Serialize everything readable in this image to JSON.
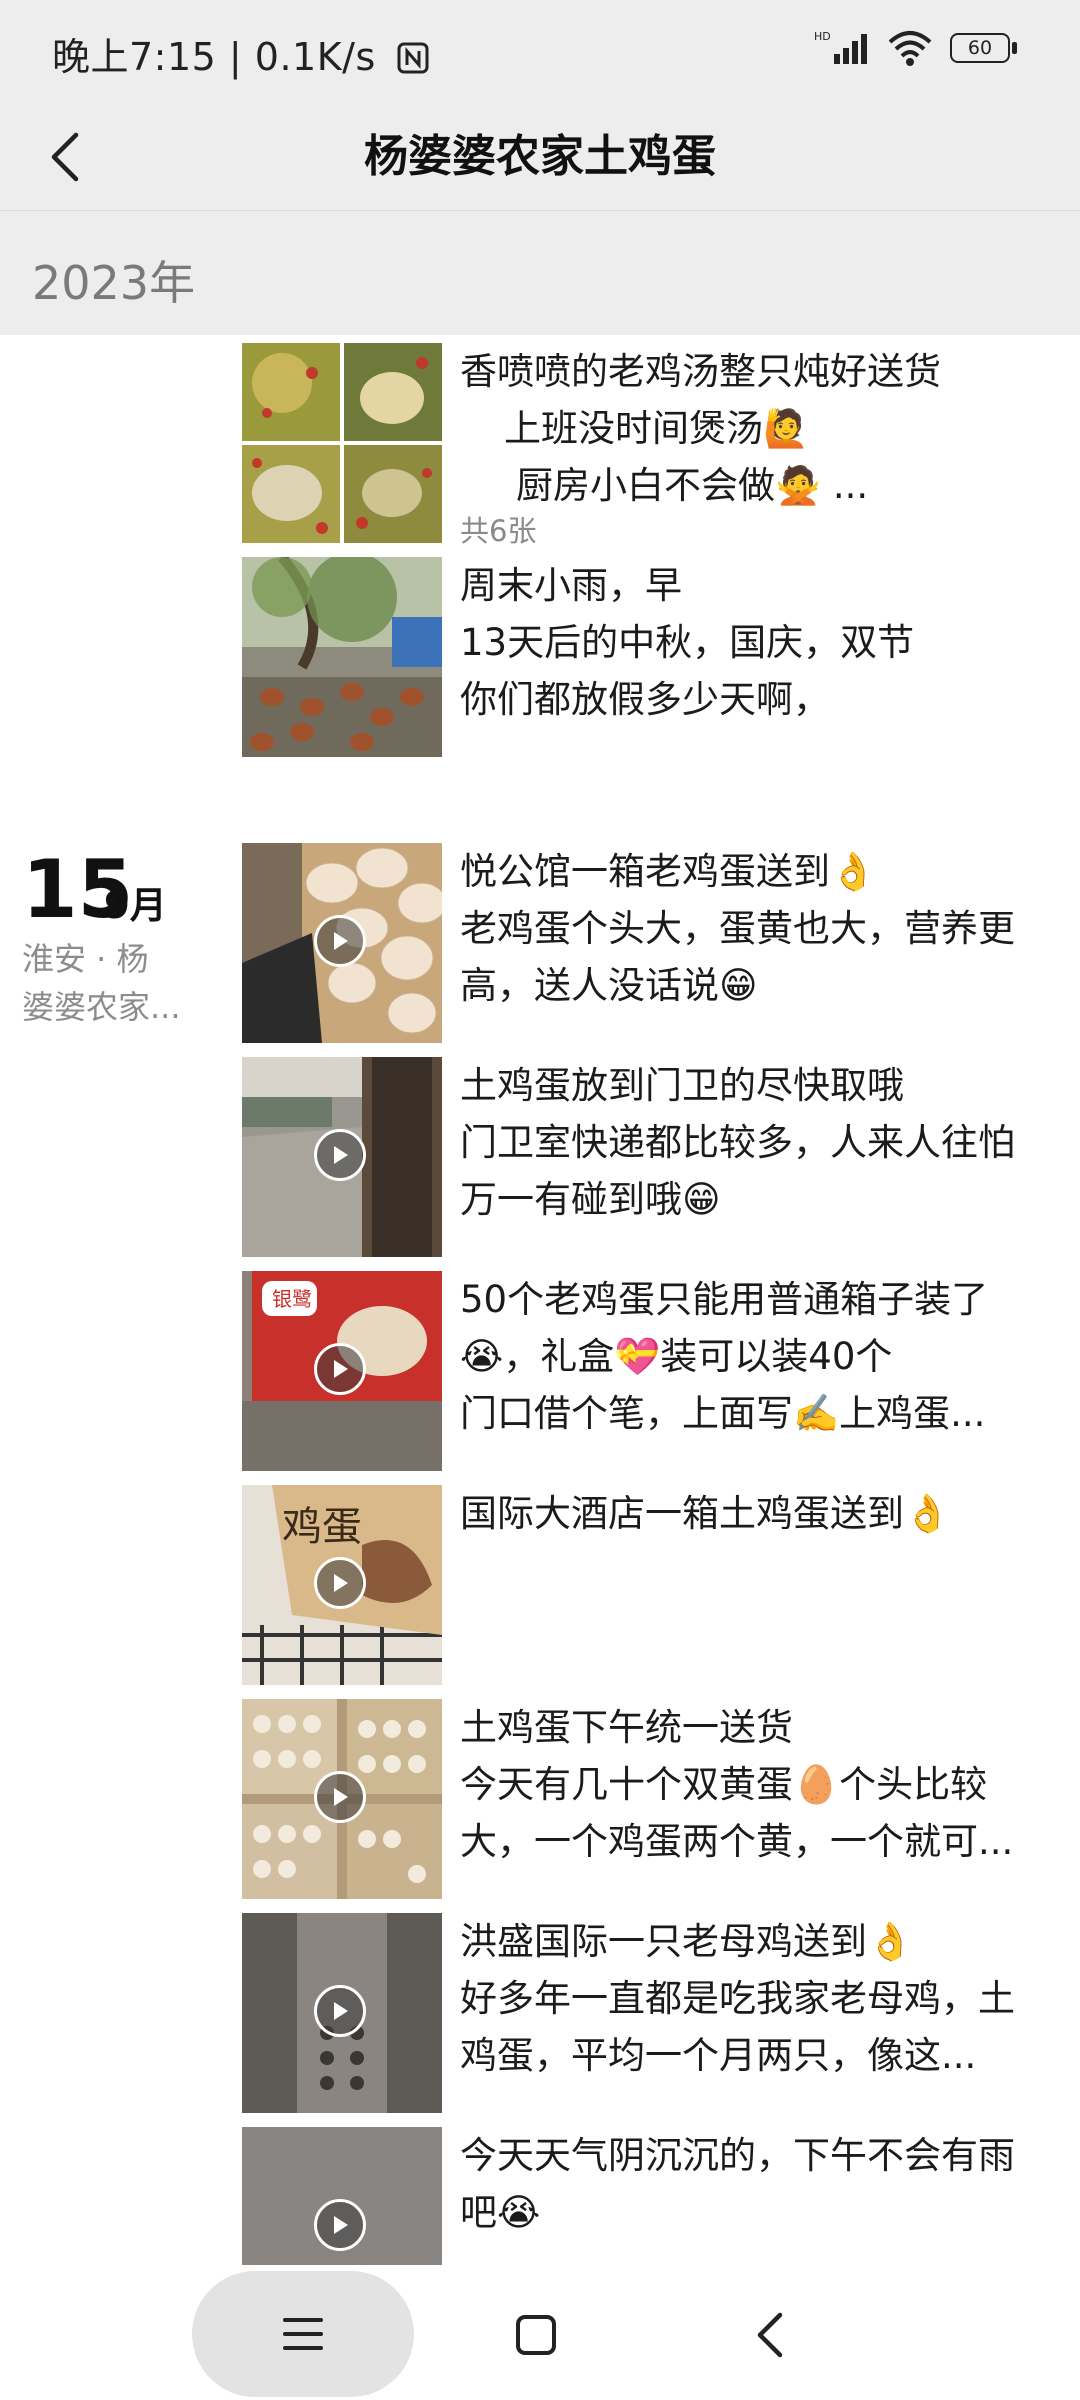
{
  "status_bar": {
    "time_text": "晚上7:15 | 0.1K/s",
    "battery": "60"
  },
  "header": {
    "title": "杨婆婆农家土鸡蛋"
  },
  "year_header": "2023年",
  "date_group": {
    "day": "15",
    "month": "9月",
    "location_line1": "淮安 · 杨",
    "location_line2": "婆婆农家..."
  },
  "posts": [
    {
      "lines": [
        "香喷喷的老鸡汤整只炖好送货",
        "上班没时间煲汤🙋",
        "厨房小白不会做🙅 ..."
      ],
      "count_label": "共6张"
    },
    {
      "lines": [
        "周末小雨，早",
        "13天后的中秋，国庆，双节",
        "你们都放假多少天啊，"
      ]
    },
    {
      "lines": [
        "悦公馆一箱老鸡蛋送到👌",
        "老鸡蛋个头大，蛋黄也大，营养更",
        "高，送人没话说😁"
      ]
    },
    {
      "lines": [
        "土鸡蛋放到门卫的尽快取哦",
        "门卫室快递都比较多，人来人往怕",
        "万一有碰到哦😁"
      ]
    },
    {
      "lines": [
        "50个老鸡蛋只能用普通箱子装了",
        "😭，礼盒💝装可以装40个",
        "门口借个笔，上面写✍️上鸡蛋..."
      ]
    },
    {
      "lines": [
        "国际大酒店一箱土鸡蛋送到👌"
      ]
    },
    {
      "lines": [
        "土鸡蛋下午统一送货",
        "今天有几十个双黄蛋🥚个头比较",
        "大，一个鸡蛋两个黄，一个就可..."
      ]
    },
    {
      "lines": [
        "洪盛国际一只老母鸡送到👌",
        "好多年一直都是吃我家老母鸡，土",
        "鸡蛋，平均一个月两只，像这..."
      ]
    },
    {
      "lines": [
        "今天天气阴沉沉的，下午不会有雨",
        "吧😭"
      ]
    }
  ],
  "thumb_labels": {
    "brand_box": "银鹭",
    "egg_box_text": "鸡蛋"
  },
  "icons": {
    "back": "chevron-left-icon",
    "play": "play-icon",
    "menu": "menu-icon",
    "home": "square-icon",
    "nav_back": "triangle-back-icon"
  },
  "colors": {
    "bar_bg": "#ededed",
    "title_text": "#111111",
    "secondary_text": "#8a8a8a"
  }
}
